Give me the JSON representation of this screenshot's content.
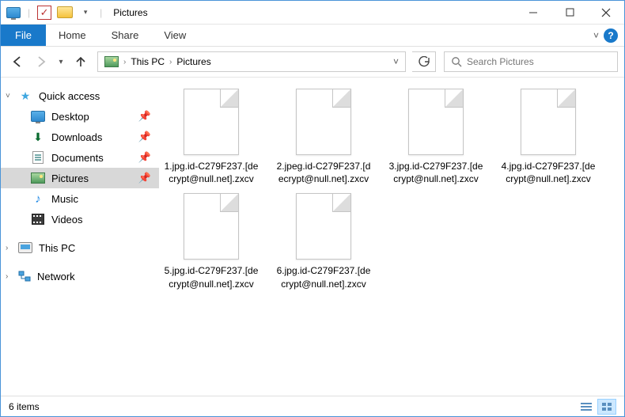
{
  "title": "Pictures",
  "tabs": {
    "file": "File",
    "home": "Home",
    "share": "Share",
    "view": "View"
  },
  "breadcrumb": [
    "This PC",
    "Pictures"
  ],
  "search_placeholder": "Search Pictures",
  "sidebar": {
    "quick_access": "Quick access",
    "items": [
      {
        "label": "Desktop",
        "icon": "desktop"
      },
      {
        "label": "Downloads",
        "icon": "downloads"
      },
      {
        "label": "Documents",
        "icon": "documents"
      },
      {
        "label": "Pictures",
        "icon": "pictures",
        "selected": true
      },
      {
        "label": "Music",
        "icon": "music"
      },
      {
        "label": "Videos",
        "icon": "videos"
      }
    ],
    "this_pc": "This PC",
    "network": "Network"
  },
  "files": [
    "1.jpg.id-C279F237.[decrypt@null.net].zxcv",
    "2.jpeg.id-C279F237.[decrypt@null.net].zxcv",
    "3.jpg.id-C279F237.[decrypt@null.net].zxcv",
    "4.jpg.id-C279F237.[decrypt@null.net].zxcv",
    "5.jpg.id-C279F237.[decrypt@null.net].zxcv",
    "6.jpg.id-C279F237.[decrypt@null.net].zxcv"
  ],
  "status": {
    "count_label": "6 items"
  }
}
